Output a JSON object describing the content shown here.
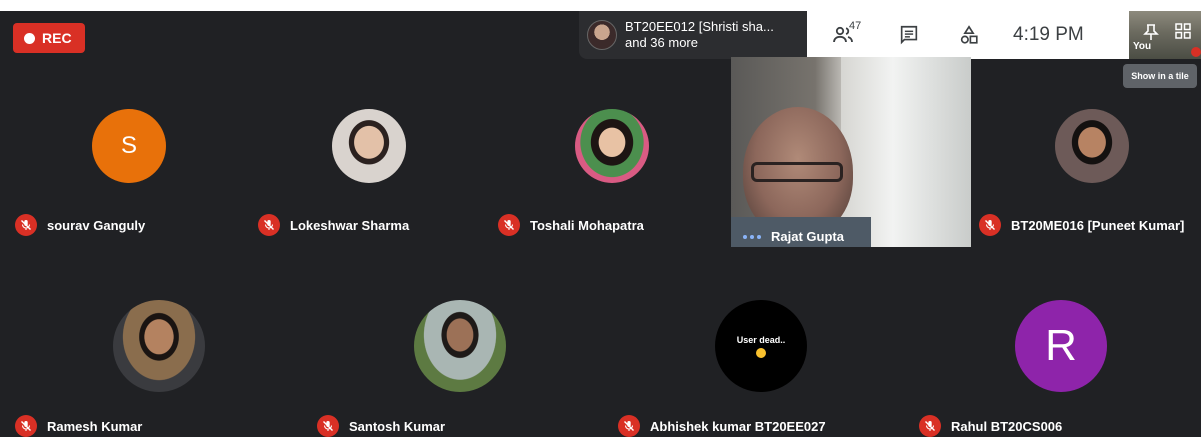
{
  "recording": {
    "label": "REC",
    "color": "#d93025"
  },
  "presenter": {
    "line1": "BT20EE012 [Shristi sha...",
    "line2": "and 36 more"
  },
  "toolbar": {
    "people_count": "47",
    "time": "4:19 PM"
  },
  "self_tile": {
    "label": "You"
  },
  "tooltip": {
    "text": "Show in a tile"
  },
  "participants": [
    {
      "name": "sourav Ganguly",
      "initial": "S",
      "avatar_color": "#e8710a",
      "muted": true
    },
    {
      "name": "Lokeshwar Sharma",
      "muted": true
    },
    {
      "name": "Toshali Mohapatra",
      "muted": true
    },
    {
      "name": "Rajat Gupta",
      "speaking": true
    },
    {
      "name": "BT20ME016 [Puneet Kumar]",
      "muted": true
    },
    {
      "name": "Ramesh Kumar",
      "muted": true
    },
    {
      "name": "Santosh Kumar",
      "muted": true
    },
    {
      "name": "Abhishek kumar BT20EE027",
      "avatar_text": "User dead..",
      "muted": true
    },
    {
      "name": "Rahul BT20CS006",
      "initial": "R",
      "avatar_color": "#8e24aa",
      "muted": true
    }
  ]
}
